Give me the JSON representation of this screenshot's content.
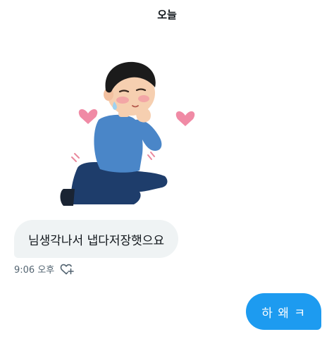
{
  "date_divider": "오늘",
  "messages": [
    {
      "direction": "received",
      "text": "님생각나서 냅다저장햇으요",
      "time": "9:06 오후"
    },
    {
      "direction": "sent",
      "text": "하 왜 ㅋ"
    }
  ],
  "sticker": {
    "icon": "blushing-kneeling-man-sticker"
  },
  "icons": {
    "react": "heart-plus-icon"
  },
  "colors": {
    "received_bubble": "#eff3f4",
    "sent_bubble": "#1d9bf0",
    "heart": "#f08aa5",
    "shirt": "#4a86c8",
    "pants": "#1e3d6b"
  }
}
